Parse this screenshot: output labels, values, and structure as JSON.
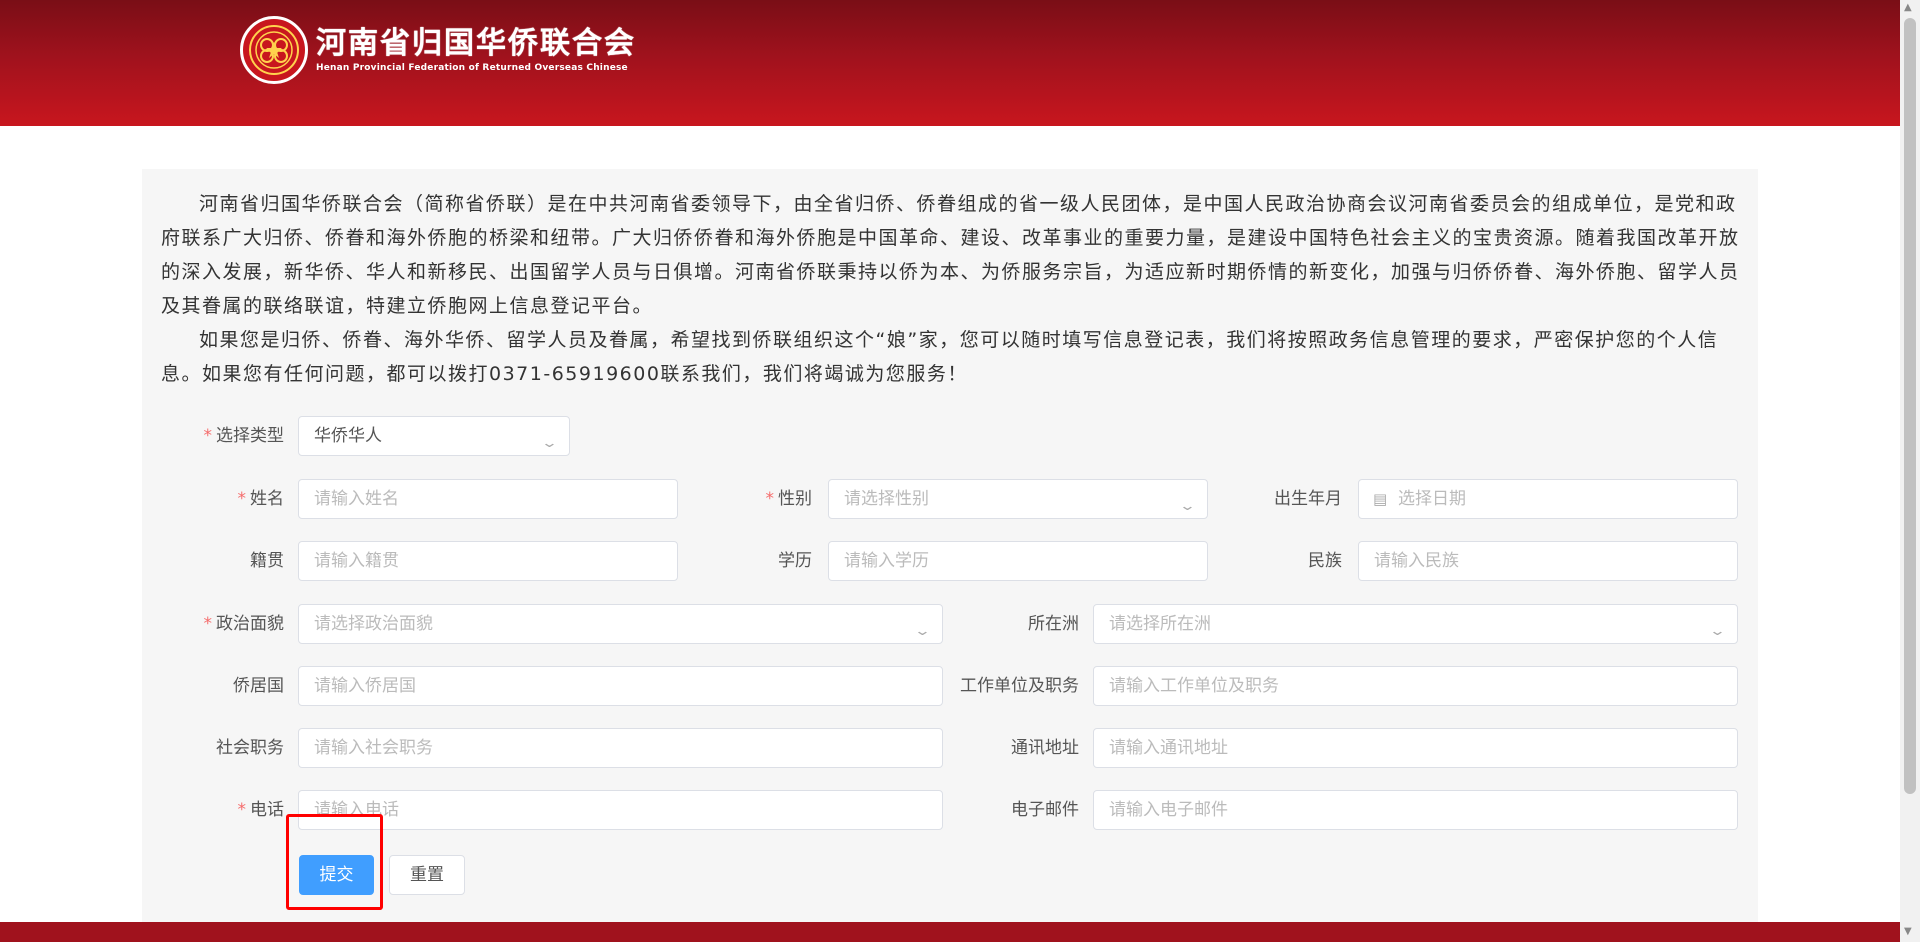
{
  "header": {
    "logo_cn": "河南省归国华侨联合会",
    "logo_en": "Henan Provincial Federation of Returned Overseas Chinese",
    "brand_color": "#c8161e"
  },
  "intro": {
    "p1": "河南省归国华侨联合会（简称省侨联）是在中共河南省委领导下，由全省归侨、侨眷组成的省一级人民团体，是中国人民政治协商会议河南省委员会的组成单位，是党和政府联系广大归侨、侨眷和海外侨胞的桥梁和纽带。广大归侨侨眷和海外侨胞是中国革命、建设、改革事业的重要力量，是建设中国特色社会主义的宝贵资源。随着我国改革开放的深入发展，新华侨、华人和新移民、出国留学人员与日俱增。河南省侨联秉持以侨为本、为侨服务宗旨，为适应新时期侨情的新变化，加强与归侨侨眷、海外侨胞、留学人员及其眷属的联络联谊，特建立侨胞网上信息登记平台。",
    "p2": "如果您是归侨、侨眷、海外华侨、留学人员及眷属，希望找到侨联组织这个“娘”家，您可以随时填写信息登记表，我们将按照政务信息管理的要求，严密保护您的个人信息。如果您有任何问题，都可以拨打0371-65919600联系我们，我们将竭诚为您服务！"
  },
  "form": {
    "type": {
      "label": "选择类型",
      "value": "华侨华人"
    },
    "name": {
      "label": "姓名",
      "placeholder": "请输入姓名"
    },
    "gender": {
      "label": "性别",
      "placeholder": "请选择性别"
    },
    "birth": {
      "label": "出生年月",
      "placeholder": "选择日期"
    },
    "native": {
      "label": "籍贯",
      "placeholder": "请输入籍贯"
    },
    "education": {
      "label": "学历",
      "placeholder": "请输入学历"
    },
    "ethnicity": {
      "label": "民族",
      "placeholder": "请输入民族"
    },
    "political": {
      "label": "政治面貌",
      "placeholder": "请选择政治面貌"
    },
    "continent": {
      "label": "所在洲",
      "placeholder": "请选择所在洲"
    },
    "country": {
      "label": "侨居国",
      "placeholder": "请输入侨居国"
    },
    "work": {
      "label": "工作单位及职务",
      "placeholder": "请输入工作单位及职务"
    },
    "social": {
      "label": "社会职务",
      "placeholder": "请输入社会职务"
    },
    "address": {
      "label": "通讯地址",
      "placeholder": "请输入通讯地址"
    },
    "phone": {
      "label": "电话",
      "placeholder": "请输入电话"
    },
    "email": {
      "label": "电子邮件",
      "placeholder": "请输入电子邮件"
    },
    "required_mark": "*",
    "submit": "提交",
    "reset": "重置"
  },
  "colors": {
    "primary": "#409eff",
    "required": "#f56c6c",
    "highlight": "#ff0000"
  }
}
